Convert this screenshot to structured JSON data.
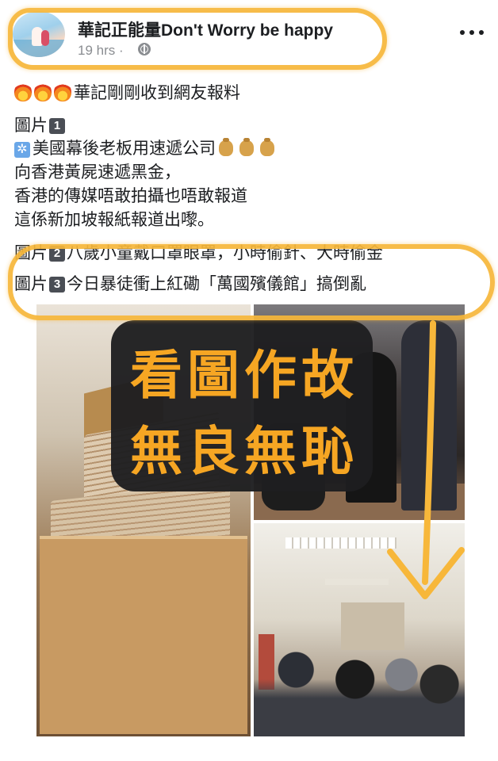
{
  "post": {
    "page_name": "華記正能量Don't Worry be happy",
    "timestamp": "19 hrs ·",
    "lines": {
      "intro": "華記剛剛收到網友報料",
      "pic1_label": "圖片",
      "pic1_num": "1",
      "pic1_text_a": "美國幕後老板用速遞公司",
      "pic1_text_b": "向香港黃屍速遞黑金，",
      "pic1_text_c": "香港的傳媒唔敢拍攝也唔敢報道",
      "pic1_text_d": "這係新加坡報紙報道出嚟。",
      "pic2_label": "圖片",
      "pic2_num": "2",
      "pic2_text": "八歲小童戴口罩眼罩，小時偷針、大時偷金",
      "pic3_label": "圖片",
      "pic3_num": "3",
      "pic3_text": "今日暴徒衝上紅磡「萬國殯儀館」搞倒亂"
    },
    "overlay": {
      "line1": "看圖作故",
      "line2": "無良無恥"
    }
  },
  "icons": {
    "more": "more-options-icon",
    "globe": "globe-icon",
    "fire": "fire-emoji",
    "money_bag": "money-bag-emoji",
    "gear": "sun-gear-emoji"
  },
  "colors": {
    "highlight": "#f7b73a",
    "caption_text": "#f6a623",
    "caption_bg": "#1e1e20"
  }
}
